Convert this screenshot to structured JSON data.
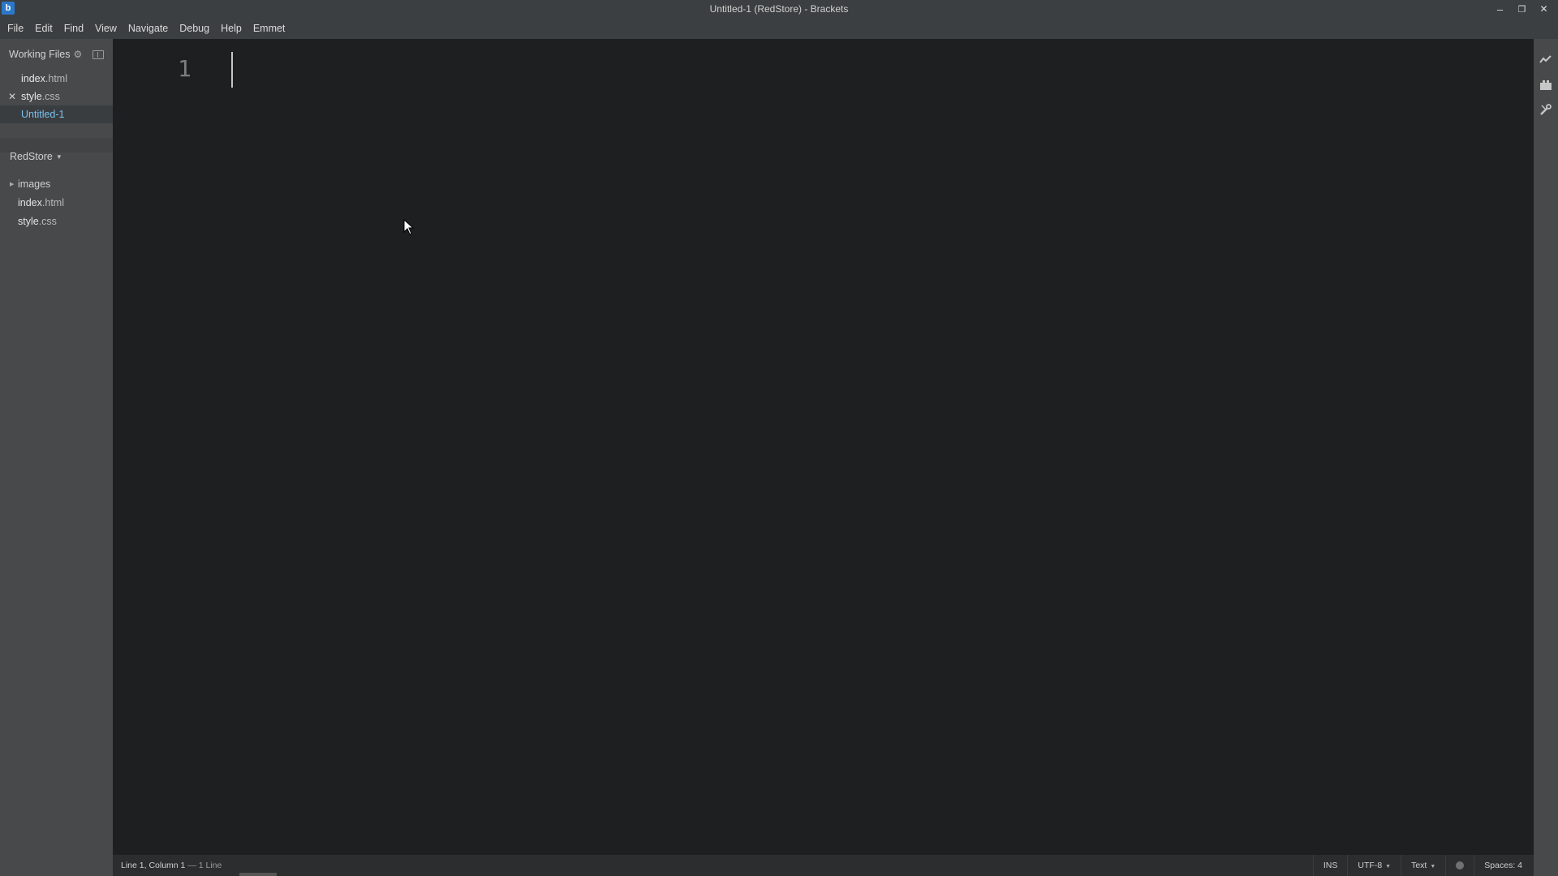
{
  "window": {
    "title": "Untitled-1 (RedStore) - Brackets",
    "app_icon_glyph": "b",
    "controls": {
      "minimize": "–",
      "maximize": "❐",
      "close": "✕"
    }
  },
  "menubar": {
    "items": [
      "File",
      "Edit",
      "Find",
      "View",
      "Navigate",
      "Debug",
      "Help",
      "Emmet"
    ]
  },
  "sidebar": {
    "working_files": {
      "title": "Working Files",
      "items": [
        {
          "name": "index",
          "ext": ".html",
          "active": false,
          "closable": false
        },
        {
          "name": "style",
          "ext": ".css",
          "active": false,
          "closable": true
        },
        {
          "name": "Untitled-1",
          "ext": "",
          "active": true,
          "closable": false
        }
      ]
    },
    "project": {
      "name": "RedStore",
      "tree": [
        {
          "name": "images",
          "ext": "",
          "type": "folder"
        },
        {
          "name": "index",
          "ext": ".html",
          "type": "file"
        },
        {
          "name": "style",
          "ext": ".css",
          "type": "file"
        }
      ]
    }
  },
  "editor": {
    "line_numbers": [
      "1"
    ]
  },
  "right_toolbar": {
    "icons": [
      "live-preview-icon",
      "extension-manager-icon",
      "tools-icon"
    ]
  },
  "statusbar": {
    "cursor_position": "Line 1, Column 1",
    "line_count": "— 1 Line",
    "mode": "INS",
    "encoding": "UTF-8",
    "language": "Text",
    "indent": "Spaces: 4"
  },
  "colors": {
    "editor_bg": "#1d1f21",
    "sidebar_bg": "#47494b",
    "active_file": "#78c2f0",
    "titlebar_bg": "#3c3f41"
  }
}
